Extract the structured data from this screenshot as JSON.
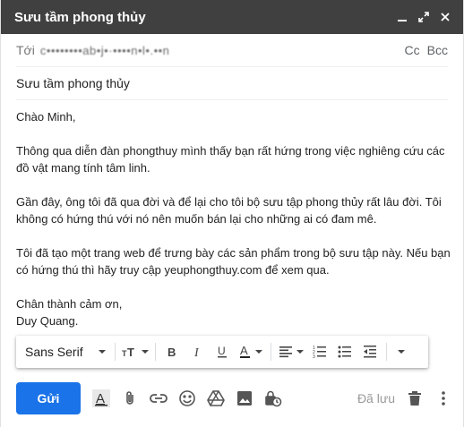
{
  "window": {
    "title": "Sưu tầm phong thủy"
  },
  "recipients": {
    "to_label": "Tới",
    "to_value": "c••••••••ab•j•·••••n•l•.••n",
    "cc": "Cc",
    "bcc": "Bcc"
  },
  "subject": "Sưu tầm phong thủy",
  "body": {
    "greeting": "Chào Minh,",
    "para1": "Thông qua diễn đàn phongthuy mình thấy bạn rất hứng trong việc nghiêng cứu các đồ vật mang tính tâm linh.",
    "para2": "Gần đây, ông tôi đã qua đời và để lại cho tôi bộ sưu tập phong thủy rất lâu đời. Tôi không có hứng thú với nó nên muốn bán lại cho những ai có đam mê.",
    "para3": "Tôi đã tạo một trang web để trưng bày các sản phẩm trong bộ sưu tập này. Nếu bạn có hứng thú thì hãy truy cập yeuphongthuy.com để xem qua.",
    "closing": "Chân thành cảm ơn,",
    "signature": "Duy Quang."
  },
  "format_toolbar": {
    "font": "Sans Serif"
  },
  "footer": {
    "send_label": "Gửi",
    "saved_label": "Đã lưu"
  },
  "colors": {
    "titlebar": "#404040",
    "send": "#1a73e8",
    "text": "#222222"
  },
  "icons": [
    "minimize-icon",
    "expand-icon",
    "close-icon",
    "text-size-icon",
    "bold-icon",
    "italic-icon",
    "underline-icon",
    "text-color-icon",
    "align-icon",
    "numbered-list-icon",
    "bulleted-list-icon",
    "indent-less-icon",
    "more-formatting-icon",
    "formatting-options-icon",
    "attach-icon",
    "link-icon",
    "emoji-icon",
    "drive-icon",
    "photo-icon",
    "confidential-icon",
    "trash-icon",
    "more-options-icon"
  ]
}
